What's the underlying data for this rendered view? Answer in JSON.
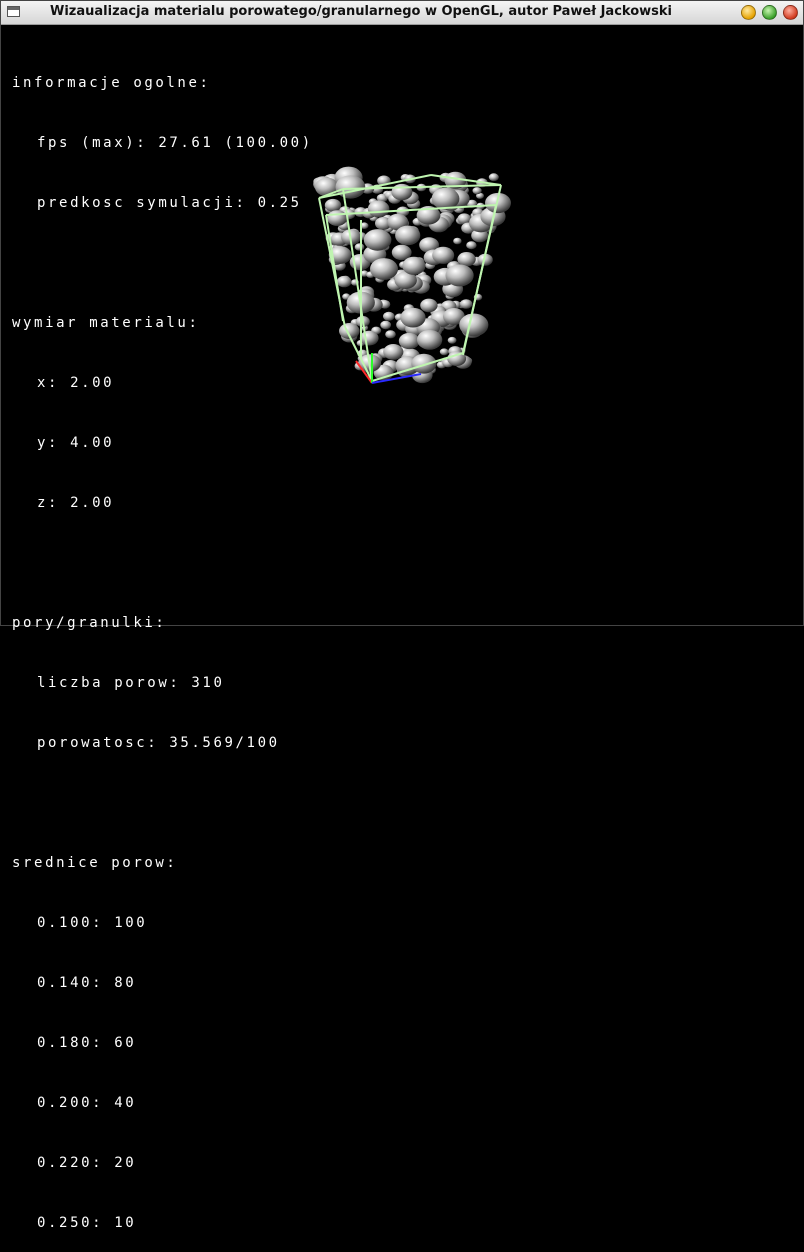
{
  "window": {
    "title": "Wizaualizacja materialu porowatego/granularnego w OpenGL, autor Paweł Jackowski"
  },
  "hud": {
    "general_header": "informacje ogolne:",
    "fps": "fps (max): 27.61 (100.00)",
    "speed": "predkosc symulacji: 0.25",
    "dims_header": "wymiar materialu:",
    "dim_x": "x: 2.00",
    "dim_y": "y: 4.00",
    "dim_z": "z: 2.00",
    "pores_header": "pory/granulki:",
    "pore_count": "liczba porow: 310",
    "porosity": "porowatosc: 35.569/100",
    "diam_header": "srednice porow:",
    "diameters": [
      "0.100: 100",
      "0.140: 80",
      "0.180: 60",
      "0.200: 40",
      "0.220: 20",
      "0.250: 10"
    ]
  },
  "colors": {
    "box_edges": "#bff5b0",
    "axis_x": "#ff2a2a",
    "axis_y": "#2aff2a",
    "axis_z": "#2a2aff",
    "granule": "#dcdcdc"
  }
}
